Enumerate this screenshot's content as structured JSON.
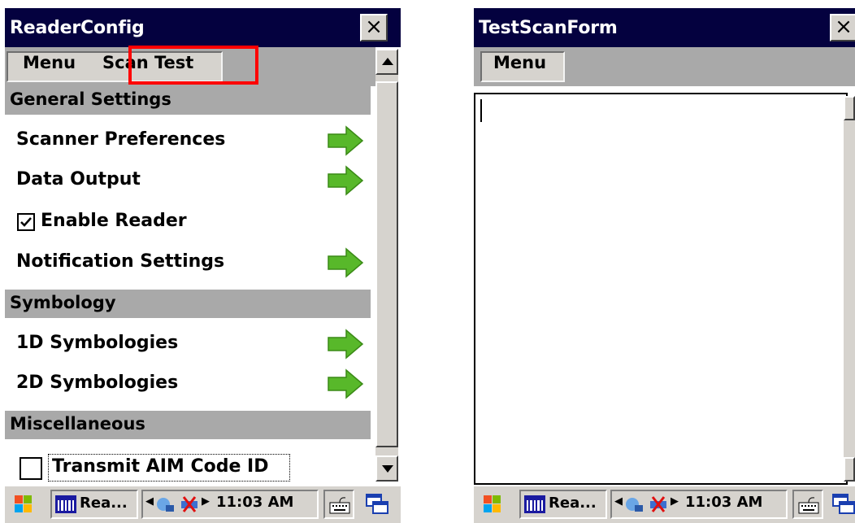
{
  "left": {
    "title": "ReaderConfig",
    "close": "×",
    "menu_label": "Menu",
    "scan_test_label": "Scan Test",
    "sections": {
      "general": "General Settings",
      "symbology": "Symbology",
      "misc": "Miscellaneous"
    },
    "items": {
      "scanner_prefs": "Scanner Preferences",
      "data_output": "Data Output",
      "enable_reader": "Enable Reader",
      "notification": "Notification Settings",
      "sym_1d": "1D Symbologies",
      "sym_2d": "2D Symbologies",
      "aim_code": "Transmit AIM Code ID"
    },
    "enable_reader_checked": true,
    "aim_code_checked": false
  },
  "right": {
    "title": "TestScanForm",
    "close": "×",
    "menu_label": "Menu"
  },
  "taskbar": {
    "app_button": "Rea...",
    "clock": "11:03 AM"
  },
  "colors": {
    "title_bg": "#04013f",
    "section_bg": "#a9a9a9",
    "arrow_green": "#58b82a",
    "highlight": "#ff0000"
  }
}
